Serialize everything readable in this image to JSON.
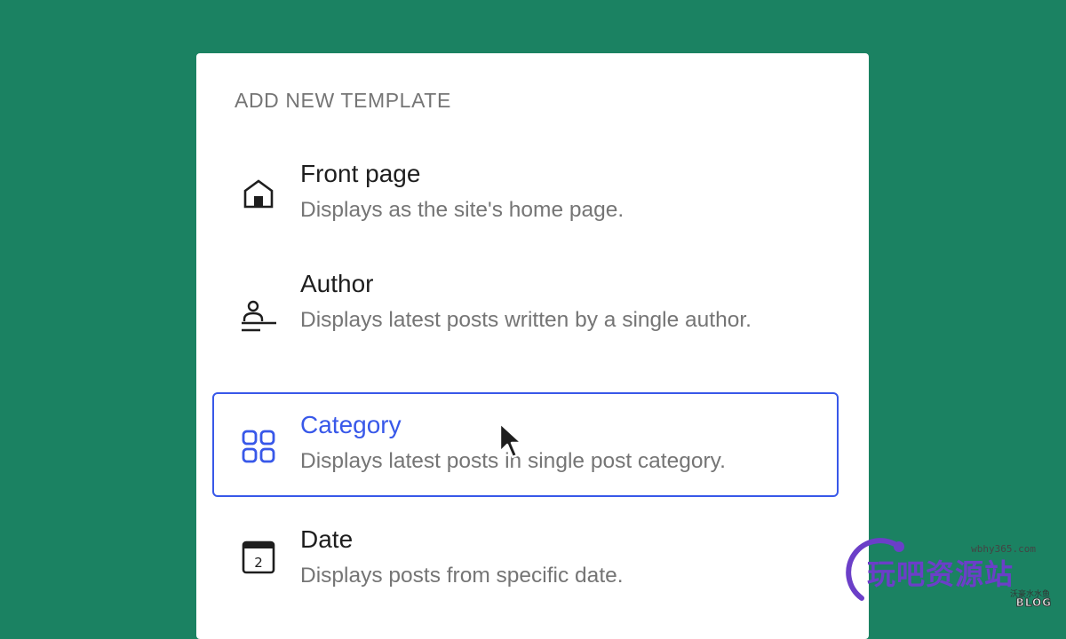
{
  "panel": {
    "title": "ADD NEW TEMPLATE"
  },
  "items": [
    {
      "label": "Front page",
      "description": "Displays as the site's home page.",
      "icon": "home-icon",
      "selected": false
    },
    {
      "label": "Author",
      "description": "Displays latest posts written by a single author.",
      "icon": "author-icon",
      "selected": false
    },
    {
      "label": "Category",
      "description": "Displays latest posts in single post category.",
      "icon": "category-grid-icon",
      "selected": true
    },
    {
      "label": "Date",
      "description": "Displays posts from specific date.",
      "icon": "calendar-icon",
      "calendar_day": "2",
      "selected": false
    }
  ],
  "colors": {
    "background": "#1b8262",
    "accent": "#3858e9",
    "text": "#1e1e1e",
    "muted": "#757575"
  },
  "watermark": {
    "url": "wbhy365.com",
    "name": "玩吧资源站",
    "sub": "沃豪水水鱼",
    "blog": "BLOG"
  }
}
